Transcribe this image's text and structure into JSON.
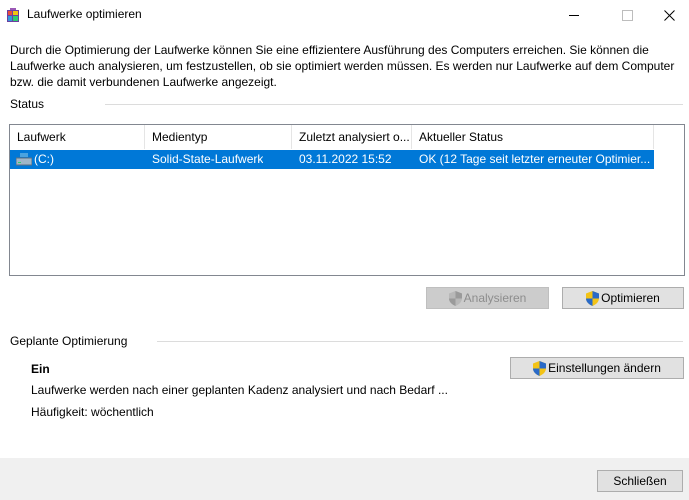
{
  "window": {
    "title": "Laufwerke optimieren"
  },
  "intro_text": "Durch die Optimierung der Laufwerke können Sie eine effizientere Ausführung des Computers erreichen. Sie können die Laufwerke auch analysieren, um festzustellen, ob sie optimiert werden müssen. Es werden nur Laufwerke auf dem Computer bzw. die damit verbundenen Laufwerke angezeigt.",
  "status": {
    "label": "Status",
    "columns": [
      "Laufwerk",
      "Medientyp",
      "Zuletzt analysiert o...",
      "Aktueller Status"
    ],
    "rows": [
      {
        "drive": "(C:)",
        "media": "Solid-State-Laufwerk",
        "last_analyzed": "03.11.2022 15:52",
        "status": "OK (12 Tage seit letzter erneuter Optimier...",
        "selected": true
      }
    ],
    "analyze_label": "Analysieren",
    "optimize_label": "Optimieren"
  },
  "schedule": {
    "label": "Geplante Optimierung",
    "state": "Ein",
    "description": "Laufwerke werden nach einer geplanten Kadenz analysiert und nach Bedarf ...",
    "frequency": "Häufigkeit: wöchentlich",
    "change_label": "Einstellungen ändern"
  },
  "footer": {
    "close_label": "Schließen"
  },
  "colors": {
    "selection": "#0078d7",
    "button_face": "#e1e1e1",
    "footer": "#f0f0f0"
  },
  "icons": [
    "defrag-app-icon",
    "drive-icon",
    "uac-shield-icon",
    "minimize-icon",
    "maximize-icon",
    "close-icon"
  ]
}
